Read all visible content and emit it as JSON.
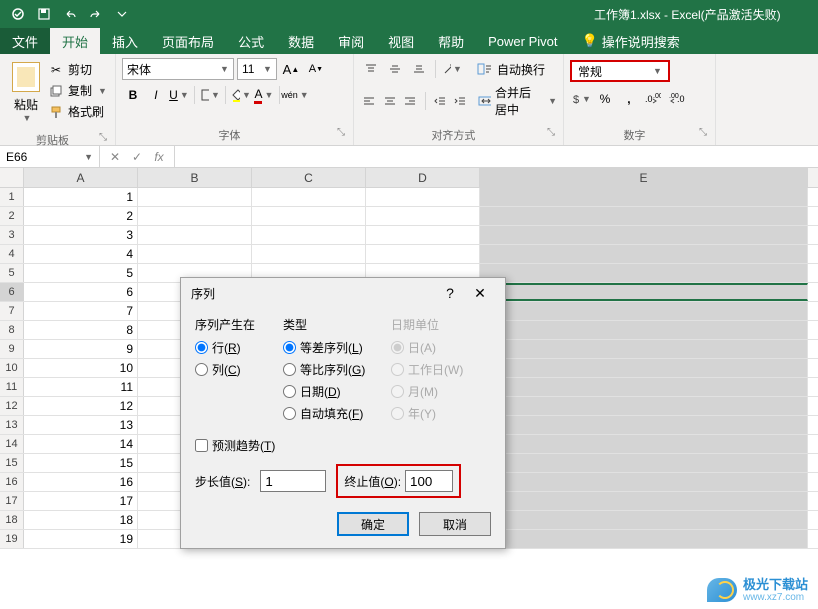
{
  "titlebar": {
    "title": "工作簿1.xlsx - Excel(产品激活失败)"
  },
  "menu": {
    "file": "文件",
    "home": "开始",
    "insert": "插入",
    "layout": "页面布局",
    "formulas": "公式",
    "data": "数据",
    "review": "审阅",
    "view": "视图",
    "help": "帮助",
    "powerpivot": "Power Pivot",
    "tellme": "操作说明搜索"
  },
  "ribbon": {
    "clipboard": {
      "paste": "粘贴",
      "cut": "剪切",
      "copy": "复制",
      "painter": "格式刷",
      "label": "剪贴板"
    },
    "font": {
      "name": "宋体",
      "size": "11",
      "wen": "wén",
      "label": "字体"
    },
    "align": {
      "wrap": "自动换行",
      "merge": "合并后居中",
      "label": "对齐方式"
    },
    "number": {
      "format": "常规",
      "label": "数字"
    }
  },
  "formula_bar": {
    "name_box": "E66",
    "fx": "fx"
  },
  "columns": [
    "A",
    "B",
    "C",
    "D",
    "E"
  ],
  "rows": [
    {
      "n": "1",
      "A": "1"
    },
    {
      "n": "2",
      "A": "2"
    },
    {
      "n": "3",
      "A": "3"
    },
    {
      "n": "4",
      "A": "4"
    },
    {
      "n": "5",
      "A": "5"
    },
    {
      "n": "6",
      "A": "6",
      "sel": true
    },
    {
      "n": "7",
      "A": "7"
    },
    {
      "n": "8",
      "A": "8"
    },
    {
      "n": "9",
      "A": "9"
    },
    {
      "n": "10",
      "A": "10"
    },
    {
      "n": "11",
      "A": "11"
    },
    {
      "n": "12",
      "A": "12"
    },
    {
      "n": "13",
      "A": "13"
    },
    {
      "n": "14",
      "A": "14"
    },
    {
      "n": "15",
      "A": "15"
    },
    {
      "n": "16",
      "A": "16"
    },
    {
      "n": "17",
      "A": "17"
    },
    {
      "n": "18",
      "A": "18"
    },
    {
      "n": "19",
      "A": "19"
    }
  ],
  "dialog": {
    "title": "序列",
    "help": "?",
    "close": "✕",
    "series_in": {
      "label": "序列产生在",
      "row": "行(",
      "row_key": "R",
      "row_end": ")",
      "col": "列(",
      "col_key": "C",
      "col_end": ")"
    },
    "type": {
      "label": "类型",
      "arith": "等差序列(",
      "arith_key": "L",
      "geo": "等比序列(",
      "geo_key": "G",
      "date": "日期(",
      "date_key": "D",
      "autofill": "自动填充(",
      "autofill_key": "F",
      "end": ")"
    },
    "date_unit": {
      "label": "日期单位",
      "day": "日(A)",
      "week": "工作日(W)",
      "month": "月(M)",
      "year": "年(Y)"
    },
    "trend": "预测趋势(",
    "trend_key": "T",
    "trend_end": ")",
    "step_label": "步长值(",
    "step_key": "S",
    "step_end": "):",
    "step_value": "1",
    "stop_label": "终止值(",
    "stop_key": "O",
    "stop_end": "):",
    "stop_value": "100",
    "ok": "确定",
    "cancel": "取消"
  },
  "watermark": {
    "name": "极光下载站",
    "url": "www.xz7.com"
  }
}
